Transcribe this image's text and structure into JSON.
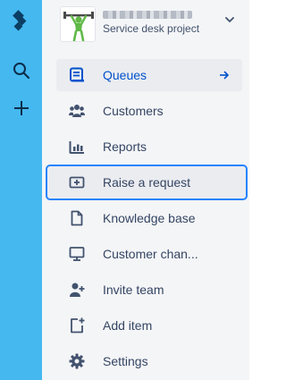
{
  "project": {
    "name": "",
    "type": "Service desk project"
  },
  "nav": {
    "queues": "Queues",
    "customers": "Customers",
    "reports": "Reports",
    "raise_request": "Raise a request",
    "knowledge_base": "Knowledge base",
    "customer_channels": "Customer chan...",
    "invite_team": "Invite team",
    "add_item": "Add item",
    "settings": "Settings"
  },
  "colors": {
    "global_nav": "#45b8f0",
    "project_nav": "#f4f5f7",
    "active_text": "#0052cc",
    "focus_outline": "#2684ff",
    "icon": "#42526e"
  }
}
